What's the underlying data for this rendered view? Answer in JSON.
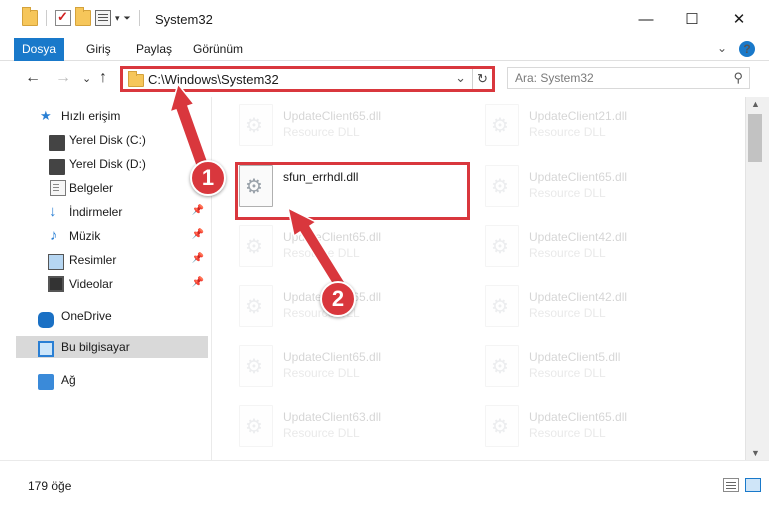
{
  "window": {
    "title": "System32",
    "minimize": "—",
    "maximize": "☐",
    "close": "✕"
  },
  "quick_access_toolbar": {
    "dropdown": "▾",
    "customize": "⏷"
  },
  "ribbon": {
    "tabs": [
      "Dosya",
      "Giriş",
      "Paylaş",
      "Görünüm"
    ],
    "expand": "⌄",
    "help": "?"
  },
  "nav": {
    "back": "←",
    "forward": "→",
    "recent": "⌄",
    "up": "↑",
    "address": "C:\\Windows\\System32",
    "address_dropdown": "⌄",
    "refresh": "↻",
    "search_placeholder": "Ara: System32",
    "search_icon": "⚲"
  },
  "sidebar": {
    "items": [
      {
        "label": "Hızlı erişim",
        "icon": "star-icon"
      },
      {
        "label": "Yerel Disk (C:)",
        "icon": "drive-icon"
      },
      {
        "label": "Yerel Disk (D:)",
        "icon": "drive-icon"
      },
      {
        "label": "Belgeler",
        "icon": "documents-icon"
      },
      {
        "label": "İndirmeler",
        "icon": "downloads-icon",
        "pinned": true
      },
      {
        "label": "Müzik",
        "icon": "music-icon",
        "pinned": true
      },
      {
        "label": "Resimler",
        "icon": "pictures-icon",
        "pinned": true
      },
      {
        "label": "Videolar",
        "icon": "videos-icon",
        "pinned": true
      },
      {
        "label": "OneDrive",
        "icon": "onedrive-icon"
      },
      {
        "label": "Bu bilgisayar",
        "icon": "this-pc-icon",
        "selected": true
      },
      {
        "label": "Ağ",
        "icon": "network-icon"
      }
    ],
    "pin_glyph": "📌"
  },
  "files": {
    "left_column": [
      {
        "name": "UpdateClient65.dll",
        "type": "Resource DLL"
      },
      {
        "name": "sfun_errhdl.dll",
        "type": ""
      },
      {
        "name": "UpdateClient65.dll",
        "type": "Resource DLL"
      },
      {
        "name": "UpdateClient65.dll",
        "type": "Resource DLL"
      },
      {
        "name": "UpdateClient65.dll",
        "type": "Resource DLL"
      },
      {
        "name": "UpdateClient63.dll",
        "type": "Resource DLL"
      }
    ],
    "right_column": [
      {
        "name": "UpdateClient21.dll",
        "type": "Resource DLL"
      },
      {
        "name": "UpdateClient65.dll",
        "type": "Resource DLL"
      },
      {
        "name": "UpdateClient42.dll",
        "type": "Resource DLL"
      },
      {
        "name": "UpdateClient42.dll",
        "type": "Resource DLL"
      },
      {
        "name": "UpdateClient5.dll",
        "type": "Resource DLL"
      },
      {
        "name": "UpdateClient65.dll",
        "type": "Resource DLL"
      }
    ]
  },
  "status": {
    "item_count": "179 öğe"
  },
  "annotations": {
    "marker_1": "1",
    "marker_2": "2",
    "color": "#d9373d"
  },
  "colors": {
    "accent": "#1979ca",
    "highlight": "#d9373d"
  }
}
